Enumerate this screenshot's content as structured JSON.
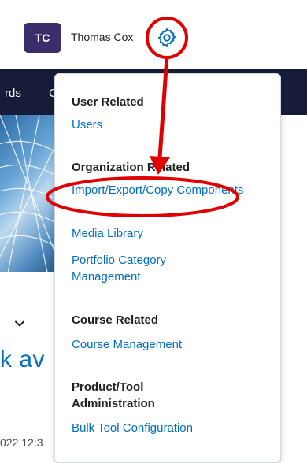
{
  "user": {
    "initials": "TC",
    "name": "Thomas Cox"
  },
  "nav": {
    "item_1": "rds",
    "item_2": "C"
  },
  "background": {
    "partial_heading": "k av",
    "partial_date": "022 12:3"
  },
  "menu": {
    "sections": [
      {
        "heading": "User Related",
        "links": [
          "Users"
        ]
      },
      {
        "heading": "Organization Related",
        "links": [
          "Import/Export/Copy Components",
          "Media Library",
          "Portfolio Category Management"
        ]
      },
      {
        "heading": "Course Related",
        "links": [
          "Course Management"
        ]
      },
      {
        "heading": "Product/Tool Administration",
        "links": [
          "Bulk Tool Configuration"
        ]
      }
    ]
  },
  "colors": {
    "accent_link": "#006fbf",
    "annotation_red": "#e10000",
    "avatar_bg": "#3b2d6b",
    "nav_bg": "#171d38"
  },
  "icons": {
    "settings": "gear-icon",
    "chevron": "chevron-down-icon"
  }
}
